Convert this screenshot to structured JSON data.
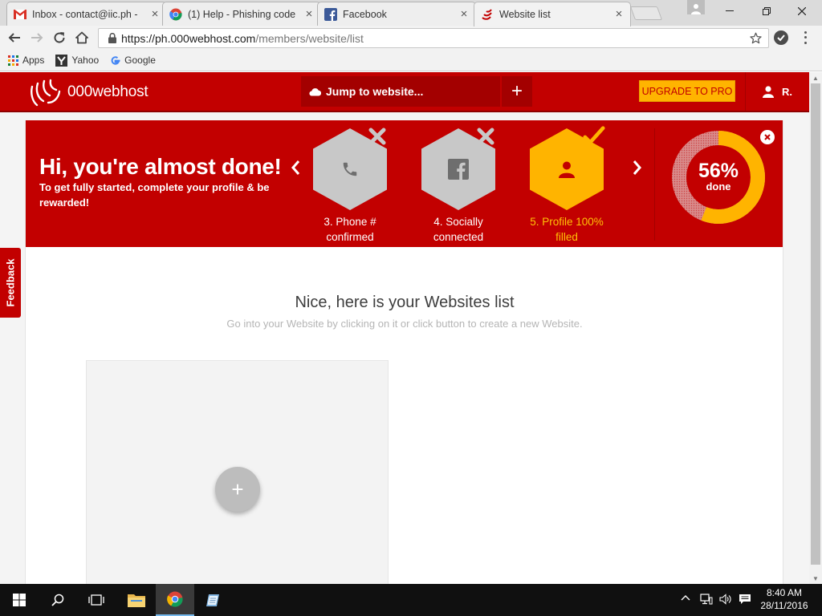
{
  "browser": {
    "tabs": [
      {
        "title": "Inbox - contact@iic.ph -",
        "icon": "gmail-icon"
      },
      {
        "title": "(1) Help - Phishing code",
        "icon": "chrome-help-icon"
      },
      {
        "title": "Facebook",
        "icon": "facebook-icon"
      },
      {
        "title": "Website list",
        "icon": "000webhost-icon"
      }
    ],
    "url_host": "https://ph.000webhost.com",
    "url_path": "/members/website/list",
    "bookmarks": [
      "Apps",
      "Yahoo",
      "Google"
    ]
  },
  "site": {
    "logo": "000webhost",
    "jump_label": "Jump to website...",
    "jump_plus": "+",
    "upgrade_label": "UPGRADE TO PRO",
    "user_initial": "R."
  },
  "banner": {
    "title": "Hi, you're almost done!",
    "subtitle": "To get fully started, complete your profile & be rewarded!",
    "steps": [
      {
        "label": "3. Phone # confirmed",
        "status": "incomplete",
        "icon": "phone-icon"
      },
      {
        "label": "4. Socially connected",
        "status": "incomplete",
        "icon": "facebook-icon"
      },
      {
        "label": "5. Profile 100% filled",
        "status": "complete",
        "icon": "user-icon"
      }
    ],
    "progress": {
      "percent": "56%",
      "label": "done",
      "value": 0.56
    },
    "colors": {
      "brand_red": "#c20000",
      "accent_yellow": "#ffb400"
    }
  },
  "main": {
    "title": "Nice, here is your Websites list",
    "subtitle": "Go into your Website by clicking on it or click button to create a new Website.",
    "add_label": "+"
  },
  "feedback_label": "Feedback",
  "taskbar": {
    "time": "8:40 AM",
    "date": "28/11/2016"
  }
}
